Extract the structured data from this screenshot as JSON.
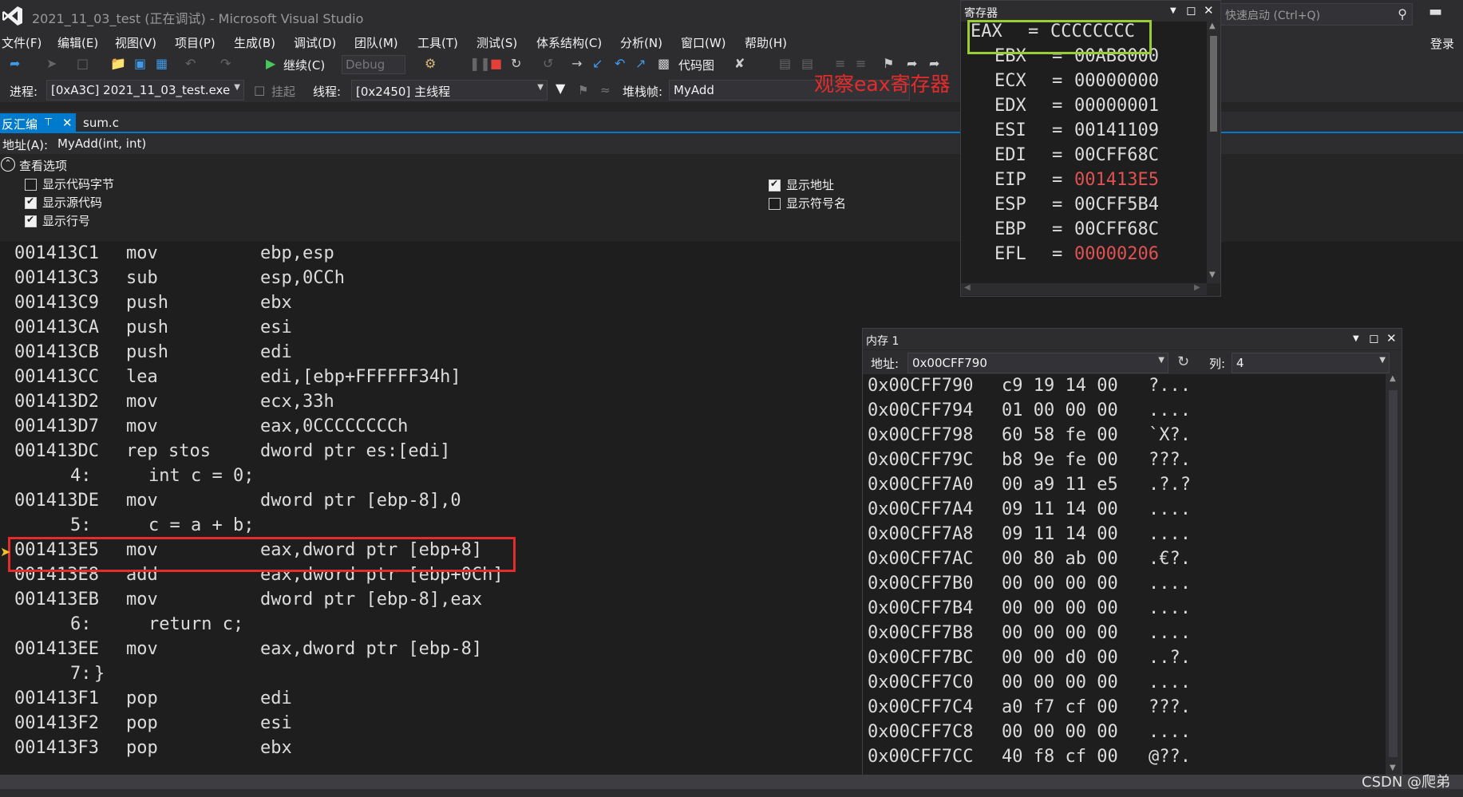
{
  "window": {
    "title": "2021_11_03_test (正在调试) - Microsoft Visual Studio",
    "quick_launch_placeholder": "快速启动 (Ctrl+Q)",
    "login": "登录",
    "minimize": "▬"
  },
  "menu": [
    "文件(F)",
    "编辑(E)",
    "视图(V)",
    "项目(P)",
    "生成(B)",
    "调试(D)",
    "团队(M)",
    "工具(T)",
    "测试(S)",
    "体系结构(C)",
    "分析(N)",
    "窗口(W)",
    "帮助(H)"
  ],
  "toolbar": {
    "continue_label": "继续(C)",
    "config": "Debug",
    "code_map_label": "代码图"
  },
  "debug_bar": {
    "process_label": "进程:",
    "process_value": "[0xA3C] 2021_11_03_test.exe",
    "suspend_label": "挂起",
    "thread_label": "线程:",
    "thread_value": "[0x2450] 主线程",
    "stackframe_label": "堆栈帧:",
    "stackframe_value": "MyAdd"
  },
  "annotation": "观察eax寄存器",
  "tabs": [
    {
      "label": "反汇编",
      "active": true
    },
    {
      "label": "sum.c",
      "active": false
    }
  ],
  "address": {
    "label": "地址(A):",
    "value": "MyAdd(int, int)"
  },
  "view_options": {
    "header": "查看选项",
    "items": [
      {
        "label": "显示代码字节",
        "checked": false
      },
      {
        "label": "显示源代码",
        "checked": true
      },
      {
        "label": "显示行号",
        "checked": true
      },
      {
        "label": "显示地址",
        "checked": true
      },
      {
        "label": "显示符号名",
        "checked": false
      }
    ]
  },
  "code_lines": [
    {
      "addr": "001413C1",
      "op": "mov",
      "args": "ebp,esp"
    },
    {
      "addr": "001413C3",
      "op": "sub",
      "args": "esp,0CCh"
    },
    {
      "addr": "001413C9",
      "op": "push",
      "args": "ebx"
    },
    {
      "addr": "001413CA",
      "op": "push",
      "args": "esi"
    },
    {
      "addr": "001413CB",
      "op": "push",
      "args": "edi"
    },
    {
      "addr": "001413CC",
      "op": "lea",
      "args": "edi,[ebp+FFFFFF34h]"
    },
    {
      "addr": "001413D2",
      "op": "mov",
      "args": "ecx,33h"
    },
    {
      "addr": "001413D7",
      "op": "mov",
      "args": "eax,0CCCCCCCCh"
    },
    {
      "addr": "001413DC",
      "op": "rep stos",
      "args": "dword ptr es:[edi]"
    },
    {
      "src_no": "4:",
      "src": "int c = 0;"
    },
    {
      "addr": "001413DE",
      "op": "mov",
      "args": "dword ptr [ebp-8],0"
    },
    {
      "src_no": "5:",
      "src": "c = a + b;"
    },
    {
      "addr": "001413E5",
      "op": "mov",
      "args": "eax,dword ptr [ebp+8]",
      "current": true
    },
    {
      "addr": "001413E8",
      "op": "add",
      "args": "eax,dword ptr [ebp+0Ch]"
    },
    {
      "addr": "001413EB",
      "op": "mov",
      "args": "dword ptr [ebp-8],eax"
    },
    {
      "src_no": "6:",
      "src": "return c;"
    },
    {
      "addr": "001413EE",
      "op": "mov",
      "args": "eax,dword ptr [ebp-8]"
    },
    {
      "src_no": "7:",
      "src": "}"
    },
    {
      "addr": "001413F1",
      "op": "pop",
      "args": "edi"
    },
    {
      "addr": "001413F2",
      "op": "pop",
      "args": "esi"
    },
    {
      "addr": "001413F3",
      "op": "pop",
      "args": "ebx"
    }
  ],
  "registers": {
    "title": "寄存器",
    "rows": [
      {
        "name": "EAX",
        "value": "CCCCCCCC",
        "changed": false
      },
      {
        "name": "EBX",
        "value": "00AB8000",
        "changed": false
      },
      {
        "name": "ECX",
        "value": "00000000",
        "changed": false
      },
      {
        "name": "EDX",
        "value": "00000001",
        "changed": false
      },
      {
        "name": "ESI",
        "value": "00141109",
        "changed": false
      },
      {
        "name": "EDI",
        "value": "00CFF68C",
        "changed": false
      },
      {
        "name": "EIP",
        "value": "001413E5",
        "changed": true
      },
      {
        "name": "ESP",
        "value": "00CFF5B4",
        "changed": false
      },
      {
        "name": "EBP",
        "value": "00CFF68C",
        "changed": false
      },
      {
        "name": "EFL",
        "value": "00000206",
        "changed": true
      }
    ]
  },
  "memory": {
    "title": "内存 1",
    "addr_label": "地址:",
    "addr_value": "0x00CFF790",
    "col_label": "列:",
    "col_value": "4",
    "rows": [
      {
        "addr": "0x00CFF790",
        "bytes": "c9 19 14 00",
        "ascii": "?..."
      },
      {
        "addr": "0x00CFF794",
        "bytes": "01 00 00 00",
        "ascii": "...."
      },
      {
        "addr": "0x00CFF798",
        "bytes": "60 58 fe 00",
        "ascii": "`X?."
      },
      {
        "addr": "0x00CFF79C",
        "bytes": "b8 9e fe 00",
        "ascii": "???."
      },
      {
        "addr": "0x00CFF7A0",
        "bytes": "00 a9 11 e5",
        "ascii": ".?.?"
      },
      {
        "addr": "0x00CFF7A4",
        "bytes": "09 11 14 00",
        "ascii": "...."
      },
      {
        "addr": "0x00CFF7A8",
        "bytes": "09 11 14 00",
        "ascii": "...."
      },
      {
        "addr": "0x00CFF7AC",
        "bytes": "00 80 ab 00",
        "ascii": ".€?."
      },
      {
        "addr": "0x00CFF7B0",
        "bytes": "00 00 00 00",
        "ascii": "...."
      },
      {
        "addr": "0x00CFF7B4",
        "bytes": "00 00 00 00",
        "ascii": "...."
      },
      {
        "addr": "0x00CFF7B8",
        "bytes": "00 00 00 00",
        "ascii": "...."
      },
      {
        "addr": "0x00CFF7BC",
        "bytes": "00 00 d0 00",
        "ascii": "..?."
      },
      {
        "addr": "0x00CFF7C0",
        "bytes": "00 00 00 00",
        "ascii": "...."
      },
      {
        "addr": "0x00CFF7C4",
        "bytes": "a0 f7 cf 00",
        "ascii": "???."
      },
      {
        "addr": "0x00CFF7C8",
        "bytes": "00 00 00 00",
        "ascii": "...."
      },
      {
        "addr": "0x00CFF7CC",
        "bytes": "40 f8 cf 00",
        "ascii": "@??."
      }
    ]
  },
  "watermark": "CSDN @爬弟",
  "colors": {
    "accent": "#007acc",
    "changed_value": "#e05252",
    "highlight_box": "#e52c2c",
    "eax_box": "#9acd32"
  }
}
